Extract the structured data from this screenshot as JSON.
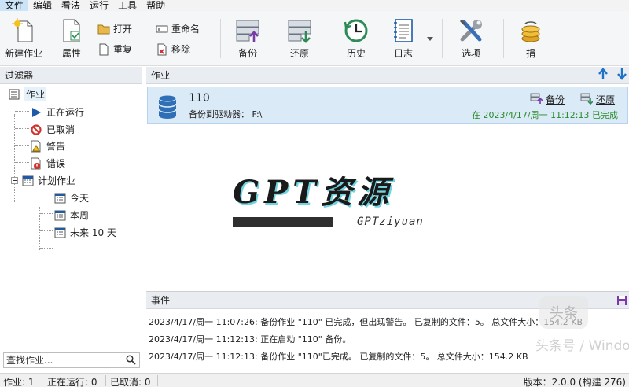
{
  "menu": [
    "文件",
    "编辑",
    "看法",
    "运行",
    "工具",
    "帮助"
  ],
  "toolbar": {
    "new_job": "新建作业",
    "properties": "属性",
    "open": "打开",
    "duplicate": "重复",
    "rename": "重命名",
    "remove": "移除",
    "backup": "备份",
    "restore": "还原",
    "history": "历史",
    "log": "日志",
    "options": "选项",
    "donate": "捐"
  },
  "filter": {
    "title": "过滤器",
    "items": {
      "jobs": "作业",
      "running": "正在运行",
      "cancelled": "已取消",
      "warning": "警告",
      "error": "错误",
      "scheduled": "计划作业",
      "today": "今天",
      "this_week": "本周",
      "next_10_days": "未来 10 天"
    },
    "search_placeholder": "查找作业..."
  },
  "jobs": {
    "title": "作业",
    "card": {
      "name": "110",
      "description": "备份到驱动器：  F:\\",
      "backup_link": "备份",
      "restore_link": "还原",
      "status": "在 2023/4/17/周一 11:12:13 已完成"
    }
  },
  "watermark": {
    "title": "GPT资源",
    "subtitle": "GPTziyuan"
  },
  "events": {
    "title": "事件",
    "rows": [
      "2023/4/17/周一 11:07:26: 备份作业 \"110\" 已完成，但出现警告。 已复制的文件：5。 总文件大小：154.2 KB",
      "2023/4/17/周一 11:12:13: 正在启动 \"110\" 备份。",
      "2023/4/17/周一 11:12:13: 备份作业 \"110\"已完成。 已复制的文件：5。 总文件大小：154.2 KB"
    ],
    "overlay_text": "头条号 / Windows 软件",
    "overlay_logo": "头条"
  },
  "status": {
    "jobs": "作业: 1",
    "running": "正在运行: 0",
    "cancelled": "已取消: 0",
    "version": "版本：2.0.0 (构建 276)"
  },
  "colors": {
    "accent": "#1e73c8",
    "selection": "#dbeaf7",
    "success": "#2a8a2a"
  }
}
